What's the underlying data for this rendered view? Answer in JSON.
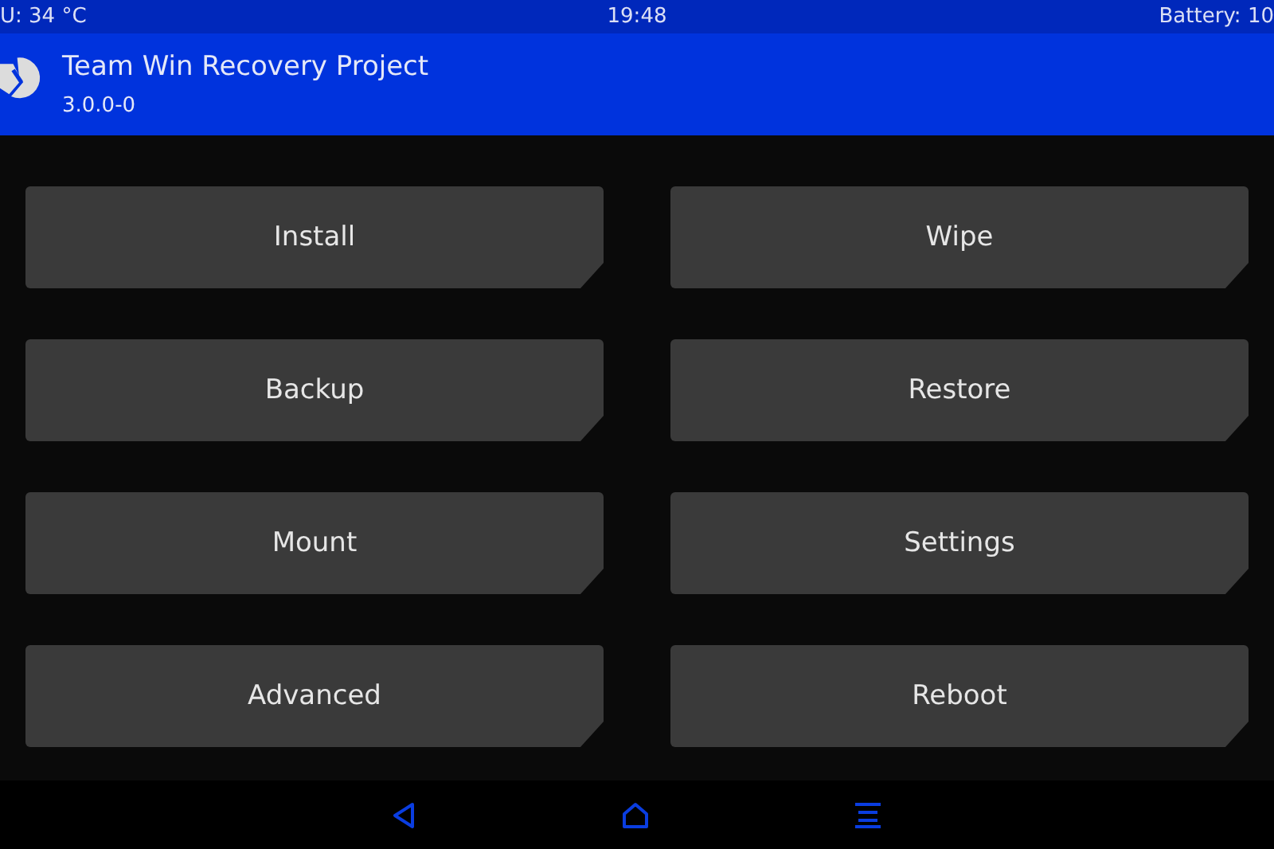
{
  "status_bar": {
    "left": "U: 34 °C",
    "center": "19:48",
    "right": "Battery: 10"
  },
  "header": {
    "title": "Team Win Recovery Project",
    "version": "3.0.0-0"
  },
  "buttons": [
    "Install",
    "Wipe",
    "Backup",
    "Restore",
    "Mount",
    "Settings",
    "Advanced",
    "Reboot"
  ]
}
